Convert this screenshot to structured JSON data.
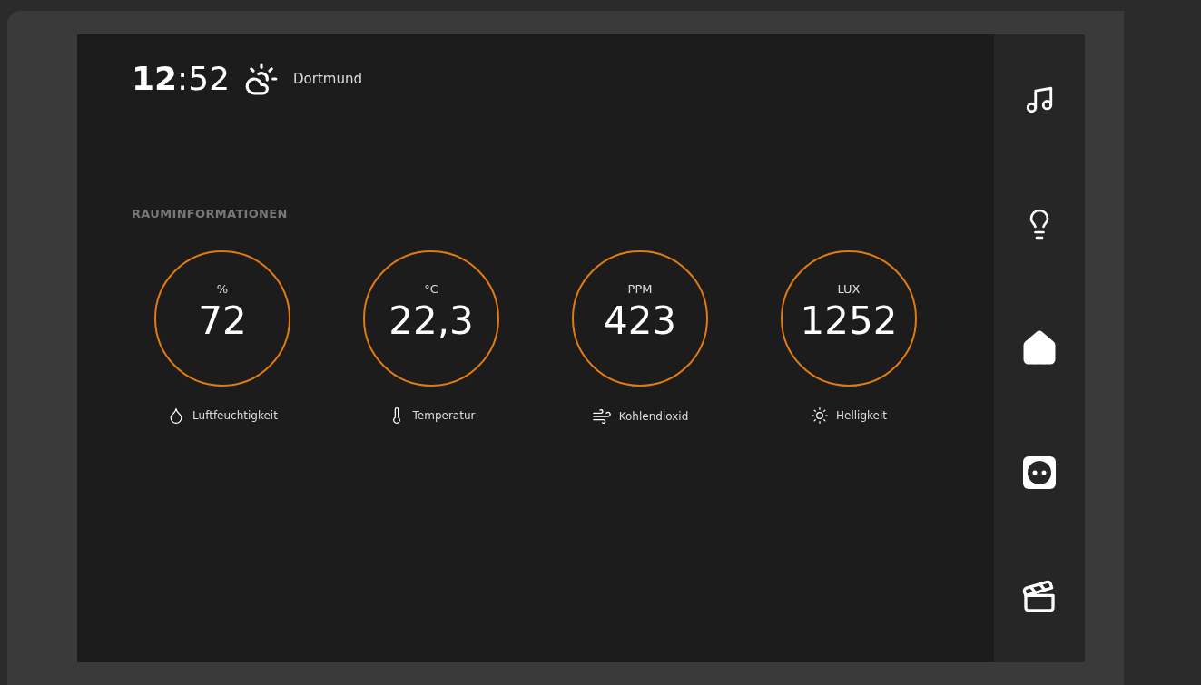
{
  "header": {
    "time_hours": "12",
    "time_minutes": ":52",
    "city": "Dortmund"
  },
  "section_title": "RAUMINFORMATIONEN",
  "sensors": [
    {
      "kind": "humidity",
      "unit": "%",
      "value": "72",
      "label": "Luftfeuchtigkeit"
    },
    {
      "kind": "temperature",
      "unit": "°C",
      "value": "22,3",
      "label": "Temperatur"
    },
    {
      "kind": "co2",
      "unit": "PPM",
      "value": "423",
      "label": "Kohlendioxid"
    },
    {
      "kind": "light",
      "unit": "LUX",
      "value": "1252",
      "label": "Helligkeit"
    }
  ],
  "sidebar": [
    {
      "kind": "music"
    },
    {
      "kind": "light"
    },
    {
      "kind": "home"
    },
    {
      "kind": "socket"
    },
    {
      "kind": "scene"
    }
  ]
}
